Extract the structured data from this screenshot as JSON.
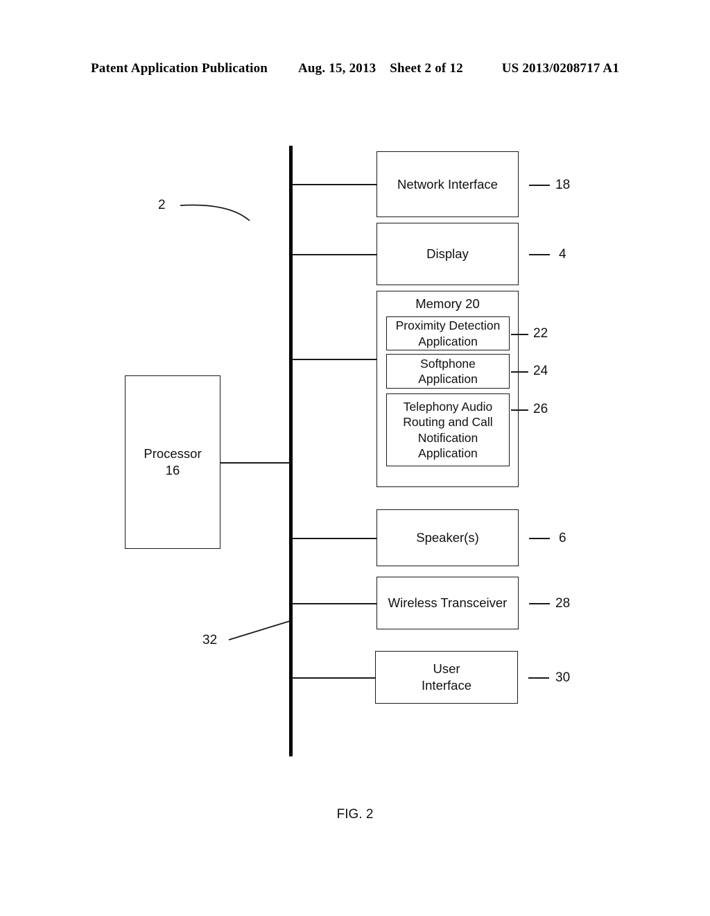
{
  "header": {
    "publication": "Patent Application Publication",
    "date": "Aug. 15, 2013",
    "sheet": "Sheet 2 of 12",
    "patent_number": "US 2013/0208717 A1"
  },
  "figure": {
    "caption": "FIG. 2",
    "system_label": "2",
    "bus_label": "32"
  },
  "blocks": {
    "network_interface": {
      "label": "Network Interface",
      "ref": "18"
    },
    "display": {
      "label": "Display",
      "ref": "4"
    },
    "memory": {
      "label": "Memory 20",
      "ref": "20"
    },
    "proximity_detection": {
      "label": "Proximity Detection\nApplication",
      "line1": "Proximity Detection",
      "line2": "Application",
      "ref": "22"
    },
    "softphone": {
      "label": "Softphone\nApplication",
      "line1": "Softphone",
      "line2": "Application",
      "ref": "24"
    },
    "telephony": {
      "label": "Telephony Audio Routing and Call Notification Application",
      "line1": "Telephony Audio",
      "line2": "Routing and Call",
      "line3": "Notification",
      "line4": "Application",
      "ref": "26"
    },
    "speakers": {
      "label": "Speaker(s)",
      "ref": "6"
    },
    "wireless_transceiver": {
      "label": "Wireless Transceiver",
      "ref": "28"
    },
    "user_interface": {
      "label": "User\nInterface",
      "line1": "User",
      "line2": "Interface",
      "ref": "30"
    },
    "processor": {
      "label": "Processor\n16",
      "line1": "Processor",
      "line2": "16",
      "ref": "16"
    }
  },
  "colors": {
    "ink": "#111111",
    "line": "#1a1a1a",
    "background": "#ffffff"
  }
}
